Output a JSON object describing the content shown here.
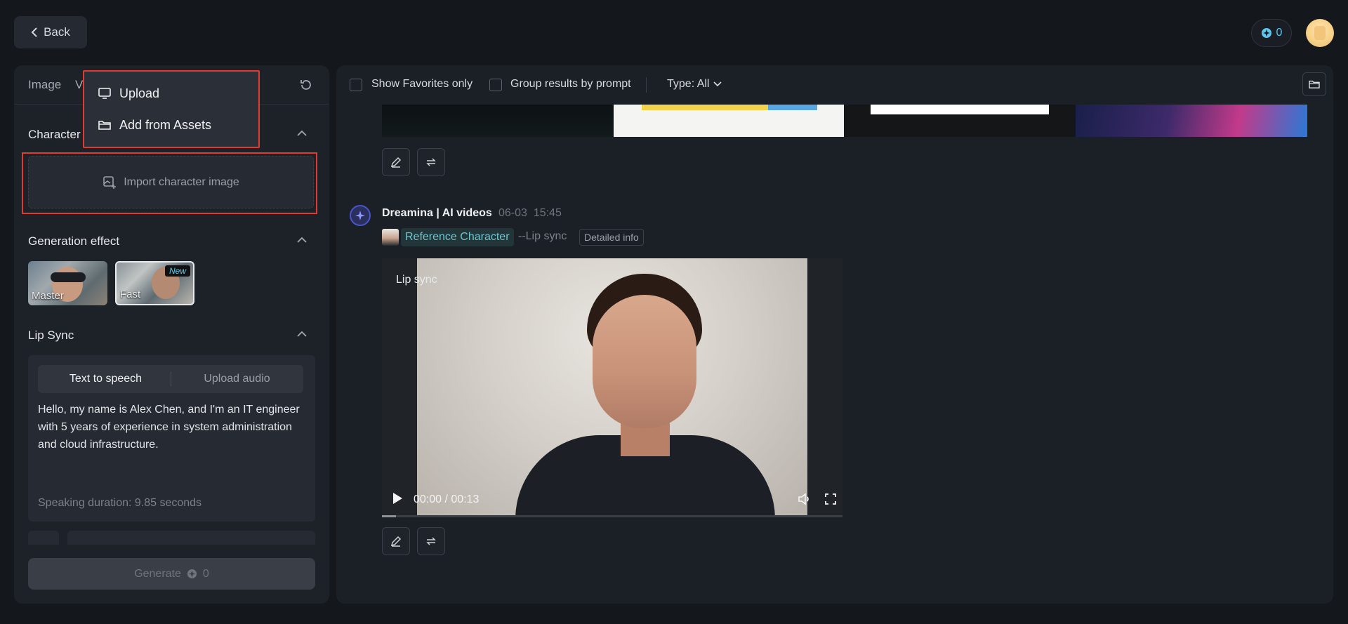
{
  "topbar": {
    "back_label": "Back",
    "credits": "0"
  },
  "left_panel": {
    "tabs": [
      "Image",
      "V"
    ],
    "character_section": {
      "title": "Character",
      "import_label": "Import character image"
    },
    "popover": {
      "items": [
        "Upload",
        "Add from Assets"
      ]
    },
    "generation_effect": {
      "title": "Generation effect",
      "options": [
        {
          "label": "Master",
          "selected": false
        },
        {
          "label": "Fast",
          "selected": true,
          "badge": "New"
        }
      ]
    },
    "lip_sync": {
      "title": "Lip Sync",
      "tabs": [
        "Text to speech",
        "Upload audio"
      ],
      "active_tab": "Text to speech",
      "speech_text": "Hello, my name is Alex Chen, and I'm an IT engineer with 5 years of experience in system administration and cloud infrastructure.",
      "duration": "Speaking duration: 9.85 seconds"
    },
    "generate": {
      "label": "Generate",
      "cost": "0"
    }
  },
  "right_panel": {
    "filters": {
      "favorites_label": "Show Favorites only",
      "group_label": "Group results by prompt",
      "type_label": "Type: All"
    },
    "result": {
      "bot_name": "Dreamina | AI videos",
      "date": "06-03",
      "time": "15:45",
      "reference_label": "Reference Character",
      "mode_tag": "--Lip sync",
      "detail_label": "Detailed info",
      "video": {
        "label": "Lip sync",
        "current_time": "00:00",
        "separator": "/",
        "duration": "00:13",
        "progress": 0.0
      }
    }
  },
  "colors": {
    "background": "#14171c",
    "panel": "#1d2128",
    "accent_cyan": "#5cc6ef",
    "highlight_red": "#e23a2e"
  }
}
